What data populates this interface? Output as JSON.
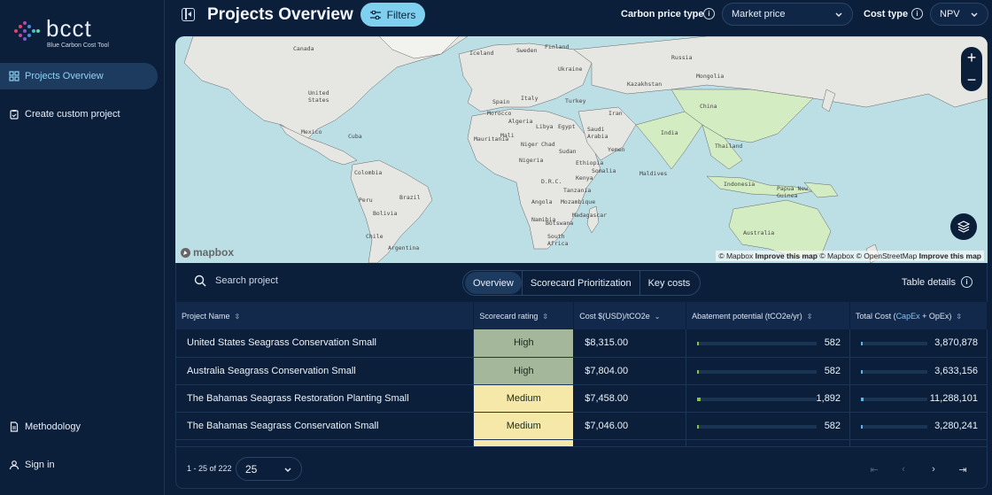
{
  "app": {
    "logo_name": "bcct",
    "logo_sub": "Blue Carbon Cost Tool"
  },
  "sidebar": {
    "items": [
      {
        "label": "Projects Overview",
        "icon": "grid-icon",
        "active": true
      },
      {
        "label": "Create custom project",
        "icon": "clipboard-icon",
        "active": false
      }
    ],
    "bottom_items": [
      {
        "label": "Methodology",
        "icon": "document-icon"
      },
      {
        "label": "Sign in",
        "icon": "user-icon"
      }
    ]
  },
  "header": {
    "title": "Projects Overview",
    "filters_label": "Filters",
    "carbon_price_type_label": "Carbon price type",
    "carbon_price_type_value": "Market price",
    "cost_type_label": "Cost type",
    "cost_type_value": "NPV"
  },
  "map": {
    "labels": [
      "Canada",
      "United States",
      "Mexico",
      "Cuba",
      "Colombia",
      "Peru",
      "Brazil",
      "Bolivia",
      "Chile",
      "Argentina",
      "Iceland",
      "Sweden",
      "Finland",
      "Ukraine",
      "Russia",
      "Kazakhstan",
      "Mongolia",
      "China",
      "Spain",
      "Italy",
      "Turkey",
      "Iran",
      "Morocco",
      "Algeria",
      "Libya",
      "Egypt",
      "Saudi Arabia",
      "Yemen",
      "Mauritania",
      "Mali",
      "Niger",
      "Chad",
      "Sudan",
      "Nigeria",
      "Ethiopia",
      "Kenya",
      "D.R.C.",
      "Angola",
      "Namibia",
      "Botswana",
      "South Africa",
      "Madagascar",
      "Maldives",
      "Thailand",
      "Indonesia",
      "Papua New Guinea",
      "Australia",
      "India",
      "Mozambique",
      "Tanzania",
      "Somalia"
    ],
    "attribution": {
      "mapbox": "© Mapbox",
      "improve": "Improve this map",
      "osm": "© OpenStreetMap"
    },
    "logo": "mapbox"
  },
  "panel": {
    "search_placeholder": "Search project",
    "tabs": [
      "Overview",
      "Scorecard Prioritization",
      "Key costs"
    ],
    "table_details_label": "Table details",
    "columns": [
      "Project Name",
      "Scorecard rating",
      "Cost $(USD)/tCO2e",
      "Abatement potential (tCO2e/yr)",
      "Total Cost ("
    ],
    "total_cost_parts": {
      "capex": "CapEx",
      "plus": " + ",
      "opex": "OpEx",
      "close": ")"
    },
    "rows": [
      {
        "name": "United States Seagrass Conservation Small",
        "rating": "High",
        "cost": "$8,315.00",
        "abatement": "582",
        "abatement_frac": 0.01,
        "total": "3,870,878",
        "total_frac": 0.012
      },
      {
        "name": "Australia Seagrass Conservation Small",
        "rating": "High",
        "cost": "$7,804.00",
        "abatement": "582",
        "abatement_frac": 0.01,
        "total": "3,633,156",
        "total_frac": 0.011
      },
      {
        "name": "The Bahamas Seagrass Restoration Planting Small",
        "rating": "Medium",
        "cost": "$7,458.00",
        "abatement": "1,892",
        "abatement_frac": 0.03,
        "total": "11,288,101",
        "total_frac": 0.03
      },
      {
        "name": "The Bahamas Seagrass Conservation Small",
        "rating": "Medium",
        "cost": "$7,046.00",
        "abatement": "582",
        "abatement_frac": 0.01,
        "total": "3,280,241",
        "total_frac": 0.01
      }
    ],
    "pager": {
      "range": "1 - 25 of 222",
      "page_size": "25"
    }
  },
  "colors": {
    "accent": "#7fd0ef",
    "high": "#a5b79a",
    "medium": "#f5e8a8",
    "bar_green": "#8ac43f",
    "bar_blue": "#5eb5e8"
  }
}
